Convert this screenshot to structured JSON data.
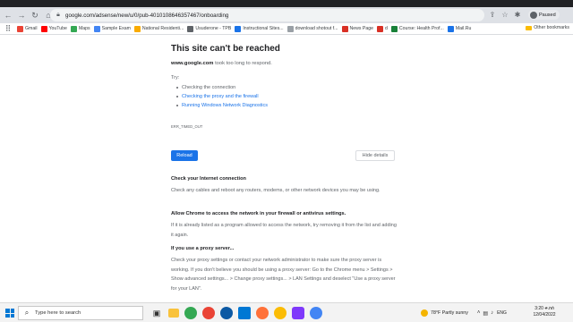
{
  "browser": {
    "url": "google.com/adsense/new/u/0/pub-4010108646357467/onboarding",
    "profile_name": "Paused",
    "bookmarks": [
      {
        "label": "Gmail",
        "color": "#ea4335"
      },
      {
        "label": "YouTube",
        "color": "#ff0000"
      },
      {
        "label": "Maps",
        "color": "#34a853"
      },
      {
        "label": "Sample Exam",
        "color": "#4285f4"
      },
      {
        "label": "National Residenti...",
        "color": "#f9ab00"
      },
      {
        "label": "Usuderone - TPB",
        "color": "#5f6368"
      },
      {
        "label": "Instructional Sites...",
        "color": "#1a73e8"
      },
      {
        "label": "download shotout f...",
        "color": "#9aa0a6"
      },
      {
        "label": "News Page",
        "color": "#d93025"
      },
      {
        "label": "d",
        "color": "#d93025"
      },
      {
        "label": "Course: Health Prof...",
        "color": "#188038"
      },
      {
        "label": "Mail.Ru",
        "color": "#1a73e8"
      }
    ],
    "other_bookmarks": "Other bookmarks"
  },
  "error_page": {
    "title": "This site can't be reached",
    "host": "www.google.com",
    "desc_rest": " took too long to respond.",
    "try_label": "Try:",
    "suggestions": [
      {
        "text": "Checking the connection",
        "link": false
      },
      {
        "text": "Checking the proxy and the firewall",
        "link": true
      },
      {
        "text": "Running Windows Network Diagnostics",
        "link": true
      }
    ],
    "error_code": "ERR_TIMED_OUT",
    "reload_label": "Reload",
    "hide_details_label": "Hide details",
    "sections": [
      {
        "heading": "Check your Internet connection",
        "body": "Check any cables and reboot any routers, modems, or other network devices you may be using."
      },
      {
        "heading": "Allow Chrome to access the network in your firewall or antivirus settings.",
        "body": "If it is already listed as a program allowed to access the network, try removing it from the list and adding it again."
      },
      {
        "heading": "If you use a proxy server...",
        "body": "Check your proxy settings or contact your network administrator to make sure the proxy server is working. If you don't believe you should be using a proxy server: Go to the Chrome menu > Settings > Show advanced settings... > Change proxy settings... > LAN Settings and deselect \"Use a proxy server for your LAN\"."
      }
    ],
    "link_color": "#1a73e8"
  },
  "taskbar": {
    "search_placeholder": "Type here to search",
    "weather": "78°F  Partly sunny",
    "language": "ENG",
    "time": "3:20 ቀ.ከሰ",
    "date": "12/04/2022"
  }
}
